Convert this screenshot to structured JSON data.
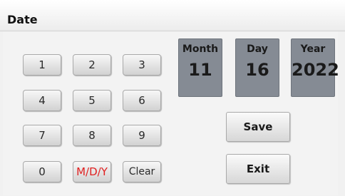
{
  "window": {
    "title": "Date"
  },
  "keypad": {
    "keys": [
      "1",
      "2",
      "3",
      "4",
      "5",
      "6",
      "7",
      "8",
      "9",
      "0",
      "M/D/Y",
      "Clear"
    ]
  },
  "date_fields": [
    {
      "label": "Month",
      "value": "11"
    },
    {
      "label": "Day",
      "value": "16"
    },
    {
      "label": "Year",
      "value": "2022"
    }
  ],
  "actions": {
    "save_label": "Save",
    "exit_label": "Exit"
  },
  "colors": {
    "field_background": "#858b94",
    "mdy_key_text": "#e02020",
    "button_gradient_top": "#f7f7f7",
    "button_gradient_bottom": "#d2d2d2"
  }
}
